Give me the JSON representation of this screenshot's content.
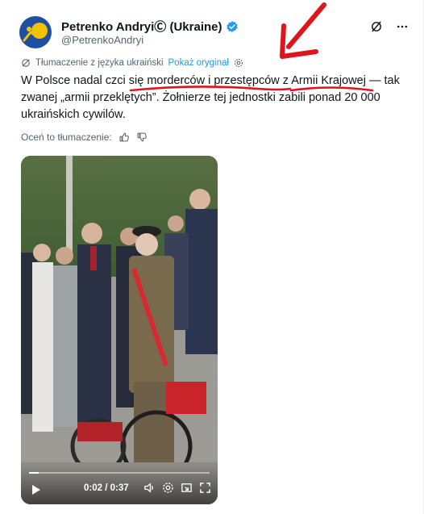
{
  "author": {
    "display_name": "Petrenko AndryiⒸ (Ukraine)",
    "handle": "@PetrenkoAndryi",
    "verified": true
  },
  "header_icons": [
    "grok-icon",
    "more-icon"
  ],
  "translation": {
    "label": "Tłumaczenie z języka ukraiński",
    "show_original": "Pokaż oryginał"
  },
  "tweet": {
    "text_part1": "W Polsce nadal czci się ",
    "text_underlined1": "morderców i przestępców",
    "text_part2": " z ",
    "text_underlined2": "Armii Krajowej",
    "text_part3": " — tak zwanej „armii przeklętych”. Żołnierze tej jednostki zabili ponad 20 000 ukraińskich cywilów."
  },
  "rate": {
    "label": "Oceń to tłumaczenie:"
  },
  "video": {
    "timecode": "0:02 / 0:37",
    "progress_fraction": 0.054
  },
  "colors": {
    "accent": "#1d9bf0",
    "annotation": "#e0141c",
    "text_secondary": "#536471"
  }
}
